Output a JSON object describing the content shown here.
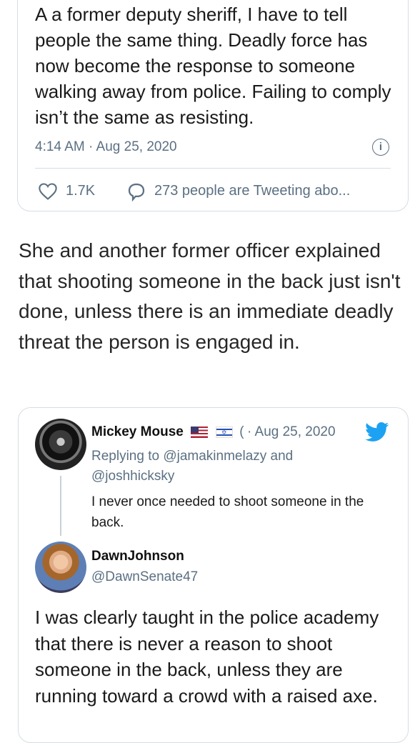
{
  "top_tweet": {
    "text": "A a former deputy sheriff, I have to tell people the same thing. Deadly force has now become the response to someone walking away from police. Failing to comply isn’t the same as resisting.",
    "timestamp": "4:14 AM · Aug 25, 2020",
    "likes": "1.7K",
    "tweeting_about": "273 people are Tweeting abo..."
  },
  "article_paragraph": "She and another former officer explained that shooting someone in the back just isn't done, unless there is an immediate deadly threat the person is engaged in.",
  "embedded_thread": {
    "reply": {
      "author_name": "Mickey Mouse",
      "name_suffix": "(",
      "date": "· Aug 25, 2020",
      "replying_to": "Replying to @jamakinmelazy and @joshhicksky",
      "text": "I never once needed to shoot someone in the back."
    },
    "main": {
      "author_name": "DawnJohnson",
      "handle": "@DawnSenate47",
      "text": "I was clearly taught in the police academy that there is never a reason to shoot someone in the back, unless they are running toward a crowd with a raised axe."
    }
  },
  "colors": {
    "twitter_blue": "#1da1f2",
    "secondary_text": "#5b7083",
    "border": "#d6dde3"
  },
  "icons": [
    "info-icon",
    "heart-icon",
    "reply-bubble-icon",
    "us-flag-icon",
    "israel-flag-icon",
    "twitter-bird-icon"
  ]
}
